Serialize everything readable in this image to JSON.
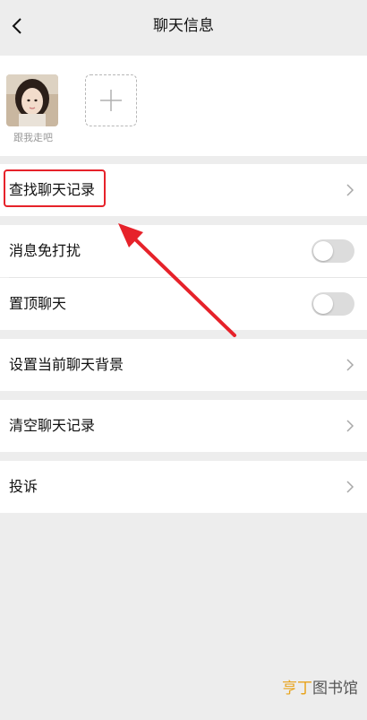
{
  "header": {
    "title": "聊天信息",
    "back_icon": "chevron-left-icon"
  },
  "members": [
    {
      "name": "跟我走吧"
    }
  ],
  "add_member_icon": "plus-icon",
  "rows": {
    "search_history": "查找聊天记录",
    "mute": "消息免打扰",
    "pin": "置顶聊天",
    "background": "设置当前聊天背景",
    "clear": "清空聊天记录",
    "report": "投诉"
  },
  "toggles": {
    "mute": false,
    "pin": false
  },
  "annotation": {
    "highlight_color": "#e6222a"
  },
  "watermark": {
    "part1": "亨丁",
    "part2": "图书馆"
  }
}
